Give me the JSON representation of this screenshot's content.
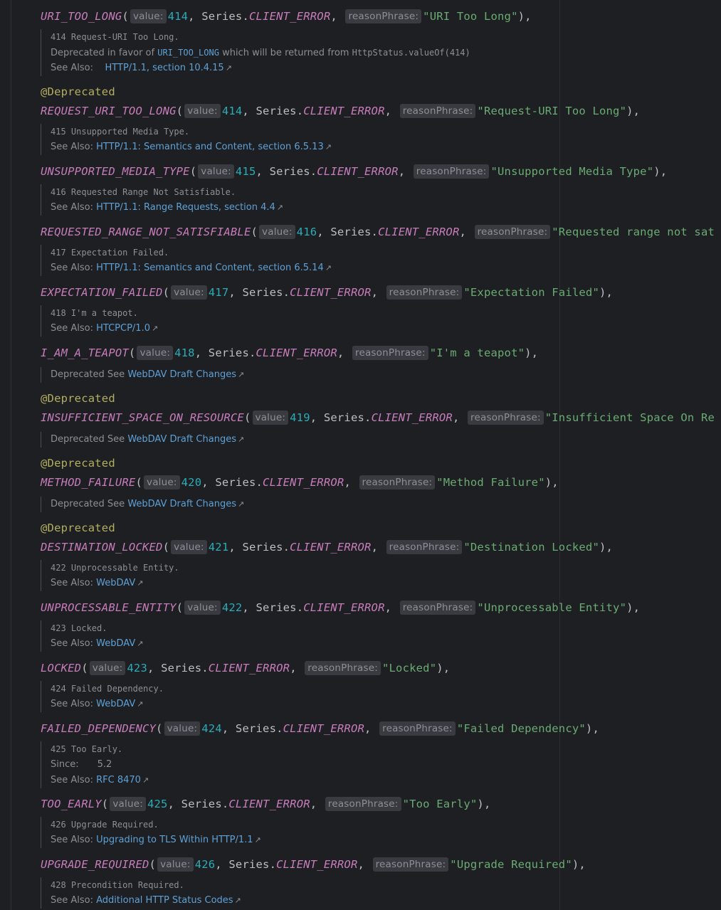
{
  "hints": {
    "value": "value:",
    "reason": "reasonPhrase:"
  },
  "series_prefix": "Series.",
  "client_error": "CLIENT_ERROR",
  "annotation": "@Deprecated",
  "entries": {
    "uri_too_long": {
      "name": "URI_TOO_LONG",
      "value": "414",
      "phrase": "\"URI Too Long\"",
      "tail": "),",
      "doc_summary": "414 Request-URI Too Long.",
      "doc_deprecated_prefix": "Deprecated in favor of",
      "doc_deprecated_code": "URI_TOO_LONG",
      "doc_deprecated_mid": "which will be returned from",
      "doc_deprecated_call": "HttpStatus.valueOf(414)",
      "see_also": "See Also:",
      "link": "HTTP/1.1, section 10.4.15"
    },
    "request_uri_too_long": {
      "name": "REQUEST_URI_TOO_LONG",
      "value": "414",
      "phrase": "\"Request-URI Too Long\"",
      "tail": "),"
    },
    "unsupported_media_type": {
      "doc_summary": "415 Unsupported Media Type.",
      "see_also": "See Also:",
      "link": "HTTP/1.1: Semantics and Content, section 6.5.13",
      "name": "UNSUPPORTED_MEDIA_TYPE",
      "value": "415",
      "phrase": "\"Unsupported Media Type\"",
      "tail": "),"
    },
    "requested_range": {
      "doc_summary": "416 Requested Range Not Satisfiable.",
      "see_also": "See Also:",
      "link": "HTTP/1.1: Range Requests, section 4.4",
      "name": "REQUESTED_RANGE_NOT_SATISFIABLE",
      "value": "416",
      "phrase": "\"Requested range not sat"
    },
    "expectation_failed": {
      "doc_summary": "417 Expectation Failed.",
      "see_also": "See Also:",
      "link": "HTTP/1.1: Semantics and Content, section 6.5.14",
      "name": "EXPECTATION_FAILED",
      "value": "417",
      "phrase": "\"Expectation Failed\"",
      "tail": "),"
    },
    "teapot": {
      "doc_summary": "418 I'm a teapot.",
      "see_also": "See Also:",
      "link": "HTCPCP/1.0",
      "name": "I_AM_A_TEAPOT",
      "value": "418",
      "phrase": "\"I'm a teapot\"",
      "tail": "),"
    },
    "insufficient_space": {
      "doc_deprecated": "Deprecated See",
      "link": "WebDAV Draft Changes",
      "name": "INSUFFICIENT_SPACE_ON_RESOURCE",
      "value": "419",
      "phrase": "\"Insufficient Space On Re"
    },
    "method_failure": {
      "doc_deprecated": "Deprecated See",
      "link": "WebDAV Draft Changes",
      "name": "METHOD_FAILURE",
      "value": "420",
      "phrase": "\"Method Failure\"",
      "tail": "),"
    },
    "destination_locked": {
      "doc_deprecated": "Deprecated See",
      "link": "WebDAV Draft Changes",
      "name": "DESTINATION_LOCKED",
      "value": "421",
      "phrase": "\"Destination Locked\"",
      "tail": "),"
    },
    "unprocessable": {
      "doc_summary": "422 Unprocessable Entity.",
      "see_also": "See Also:",
      "link": "WebDAV",
      "name": "UNPROCESSABLE_ENTITY",
      "value": "422",
      "phrase": "\"Unprocessable Entity\"",
      "tail": "),"
    },
    "locked": {
      "doc_summary": "423 Locked.",
      "see_also": "See Also:",
      "link": "WebDAV",
      "name": "LOCKED",
      "value": "423",
      "phrase": "\"Locked\"",
      "tail": "),"
    },
    "failed_dependency": {
      "doc_summary": "424 Failed Dependency.",
      "see_also": "See Also:",
      "link": "WebDAV",
      "name": "FAILED_DEPENDENCY",
      "value": "424",
      "phrase": "\"Failed Dependency\"",
      "tail": "),"
    },
    "too_early": {
      "doc_summary": "425 Too Early.",
      "since_label": "Since:",
      "since_value": "5.2",
      "see_also": "See Also:",
      "link": "RFC 8470",
      "name": "TOO_EARLY",
      "value": "425",
      "phrase": "\"Too Early\"",
      "tail": "),"
    },
    "upgrade_required": {
      "doc_summary": "426 Upgrade Required.",
      "see_also": "See Also:",
      "link": "Upgrading to TLS Within HTTP/1.1",
      "name": "UPGRADE_REQUIRED",
      "value": "426",
      "phrase": "\"Upgrade Required\"",
      "tail": "),"
    },
    "precondition_required": {
      "doc_summary": "428 Precondition Required.",
      "see_also": "See Also:",
      "link": "Additional HTTP Status Codes"
    }
  }
}
